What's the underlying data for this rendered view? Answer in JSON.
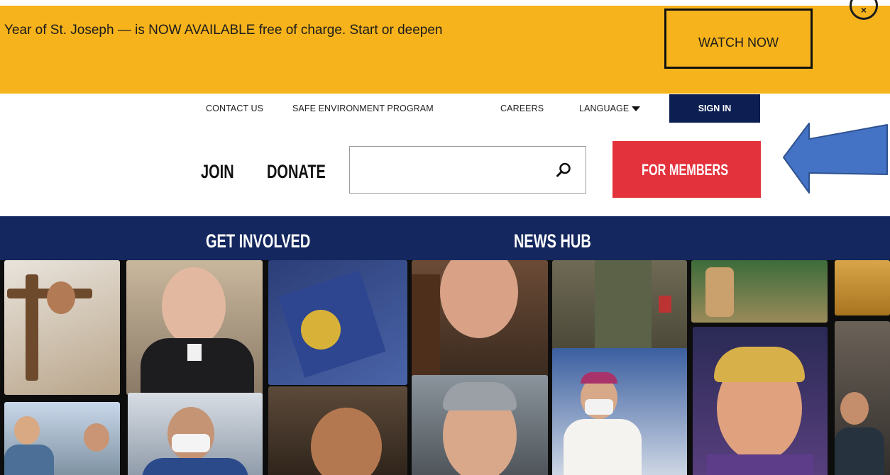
{
  "banner": {
    "text": "Year of St. Joseph — is NOW AVAILABLE free of charge. Start or deepen",
    "watch_label": "WATCH NOW",
    "close_glyph": "×",
    "color": "#f6b31c"
  },
  "utility_nav": {
    "contact": "CONTACT US",
    "safe_env": "SAFE ENVIRONMENT PROGRAM",
    "careers": "CAREERS",
    "language": "LANGUAGE",
    "sign_in": "SIGN IN",
    "sign_in_color": "#0c1e52"
  },
  "header": {
    "join": "JOIN",
    "donate": "DONATE",
    "search_placeholder": "",
    "search_icon": "search-icon",
    "for_members": "FOR MEMBERS",
    "for_members_color": "#e3323c"
  },
  "annotation": {
    "icon": "arrow-left-icon",
    "color": "#4472c4"
  },
  "main_nav": {
    "items": [
      {
        "label": "GET INVOLVED"
      },
      {
        "label": "NEWS HUB"
      }
    ],
    "color": "#14275e"
  },
  "hero": {
    "description": "photo-mosaic"
  }
}
